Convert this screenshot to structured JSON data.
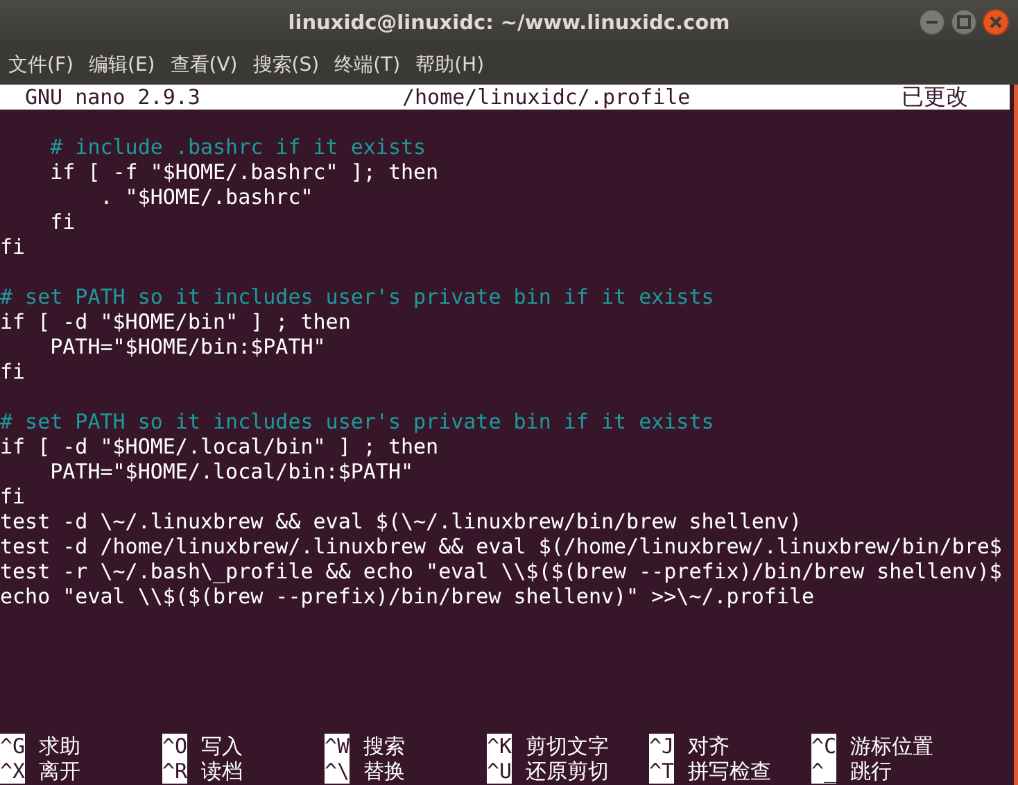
{
  "window": {
    "title": "linuxidc@linuxidc: ~/www.linuxidc.com"
  },
  "menu": [
    "文件(F)",
    "编辑(E)",
    "查看(V)",
    "搜索(S)",
    "终端(T)",
    "帮助(H)"
  ],
  "nano_header": {
    "version": "GNU nano 2.9.3",
    "filename": "/home/linuxidc/.profile",
    "status": "已更改"
  },
  "lines": [
    {
      "kind": "blank"
    },
    {
      "kind": "comment",
      "text": "    # include .bashrc if it exists"
    },
    {
      "kind": "code",
      "text": "    if [ -f \"$HOME/.bashrc\" ]; then"
    },
    {
      "kind": "code",
      "text": "        . \"$HOME/.bashrc\""
    },
    {
      "kind": "code",
      "text": "    fi"
    },
    {
      "kind": "code",
      "text": "fi"
    },
    {
      "kind": "blank"
    },
    {
      "kind": "comment",
      "text": "# set PATH so it includes user's private bin if it exists"
    },
    {
      "kind": "code",
      "text": "if [ -d \"$HOME/bin\" ] ; then"
    },
    {
      "kind": "code",
      "text": "    PATH=\"$HOME/bin:$PATH\""
    },
    {
      "kind": "code",
      "text": "fi"
    },
    {
      "kind": "blank"
    },
    {
      "kind": "comment",
      "text": "# set PATH so it includes user's private bin if it exists"
    },
    {
      "kind": "code",
      "text": "if [ -d \"$HOME/.local/bin\" ] ; then"
    },
    {
      "kind": "code",
      "text": "    PATH=\"$HOME/.local/bin:$PATH\""
    },
    {
      "kind": "code",
      "text": "fi"
    },
    {
      "kind": "code",
      "text": "test -d \\~/.linuxbrew && eval $(\\~/.linuxbrew/bin/brew shellenv)"
    },
    {
      "kind": "code",
      "text": "test -d /home/linuxbrew/.linuxbrew && eval $(/home/linuxbrew/.linuxbrew/bin/bre$"
    },
    {
      "kind": "code",
      "text": "test -r \\~/.bash\\_profile && echo \"eval \\\\$($(brew --prefix)/bin/brew shellenv)$"
    },
    {
      "kind": "code",
      "text": "echo \"eval \\\\$($(brew --prefix)/bin/brew shellenv)\" >>\\~/.profile"
    }
  ],
  "shortcuts": [
    {
      "key": "^G",
      "label": "求助"
    },
    {
      "key": "^O",
      "label": "写入"
    },
    {
      "key": "^W",
      "label": "搜索"
    },
    {
      "key": "^K",
      "label": "剪切文字"
    },
    {
      "key": "^J",
      "label": "对齐"
    },
    {
      "key": "^C",
      "label": "游标位置"
    },
    {
      "key": "^X",
      "label": "离开"
    },
    {
      "key": "^R",
      "label": "读档"
    },
    {
      "key": "^\\",
      "label": "替换"
    },
    {
      "key": "^U",
      "label": "还原剪切"
    },
    {
      "key": "^T",
      "label": "拼写检查"
    },
    {
      "key": "^_",
      "label": "跳行"
    }
  ]
}
